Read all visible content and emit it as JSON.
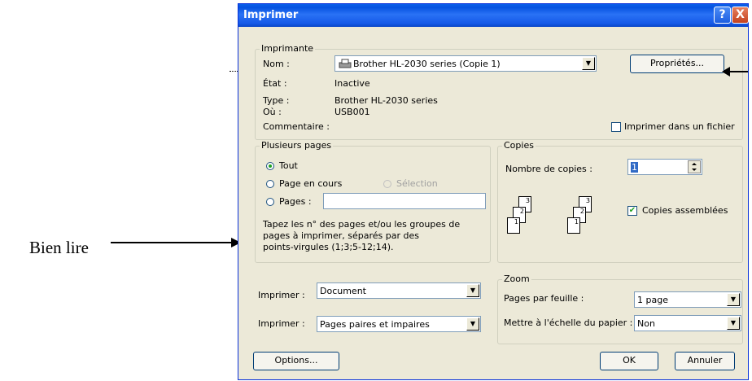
{
  "annotation": {
    "text": "Bien lire"
  },
  "window": {
    "title": "Imprimer",
    "help_glyph": "?",
    "close_glyph": "X"
  },
  "printer": {
    "legend": "Imprimante",
    "name_label": "Nom :",
    "name_value": "Brother HL-2030 series (Copie 1)",
    "properties_button": "Propriétés...",
    "state_label": "État :",
    "state_value": "Inactive",
    "type_label": "Type :",
    "type_value": "Brother HL-2030 series",
    "where_label": "Où :",
    "where_value": "USB001",
    "comment_label": "Commentaire :",
    "print_to_file_label": "Imprimer dans un fichier",
    "print_to_file_checked": false
  },
  "pages": {
    "legend": "Plusieurs pages",
    "all_label": "Tout",
    "current_label": "Page en cours",
    "selection_label": "Sélection",
    "pages_label": "Pages :",
    "pages_value": "",
    "selected": "all",
    "help_text_1": "Tapez les n° des pages et/ou les groupes de",
    "help_text_2": "pages à imprimer, séparés par des",
    "help_text_3": "points-virgules (1;3;5-12;14)."
  },
  "copies": {
    "legend": "Copies",
    "count_label": "Nombre de copies :",
    "count_value": "1",
    "collate_label": "Copies assemblées",
    "collate_checked": true,
    "page_numbers": [
      "3",
      "2",
      "1"
    ]
  },
  "print_what": {
    "label": "Imprimer :",
    "value": "Document"
  },
  "print_pages": {
    "label": "Imprimer :",
    "value": "Pages paires et impaires"
  },
  "zoom": {
    "legend": "Zoom",
    "per_sheet_label": "Pages par feuille :",
    "per_sheet_value": "1 page",
    "scale_label": "Mettre à l'échelle du papier :",
    "scale_value": "Non"
  },
  "buttons": {
    "options": "Options...",
    "ok": "OK",
    "cancel": "Annuler"
  },
  "colors": {
    "titlebar": "#0552e0",
    "dialog_bg": "#ece9d8",
    "close_button": "#c4421f"
  }
}
